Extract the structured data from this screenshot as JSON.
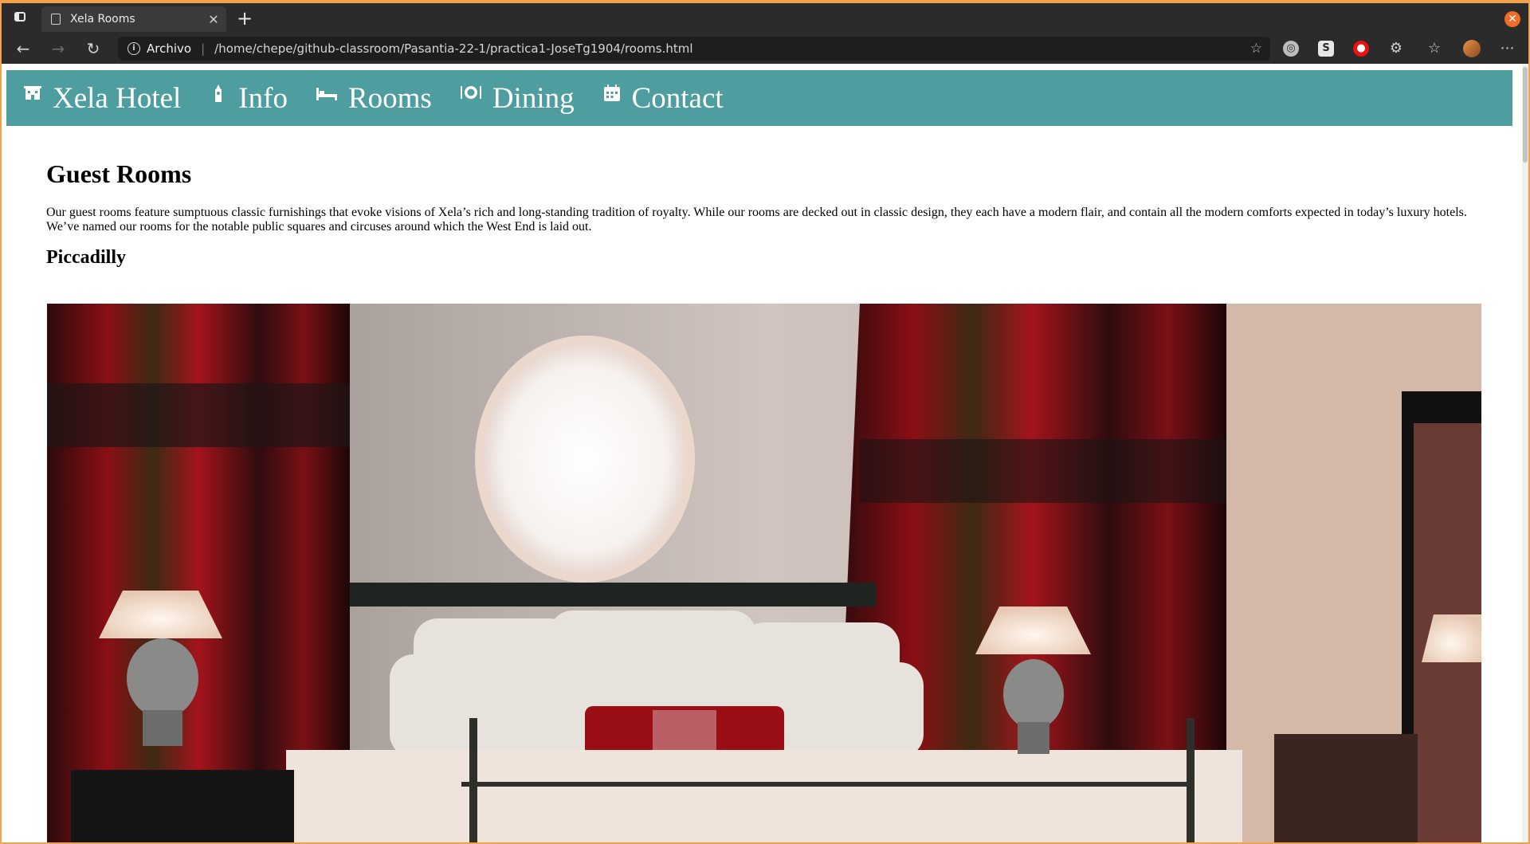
{
  "browser": {
    "tab_title": "Xela Rooms",
    "url_scheme_label": "Archivo",
    "url": "/home/chepe/github-classroom/Pasantia-22-1/practica1-JoseTg1904/rooms.html"
  },
  "site": {
    "nav": [
      {
        "label": "Xela Hotel",
        "icon": "hotel-icon"
      },
      {
        "label": "Info",
        "icon": "landmark-icon"
      },
      {
        "label": "Rooms",
        "icon": "bed-icon"
      },
      {
        "label": "Dining",
        "icon": "dining-icon"
      },
      {
        "label": "Contact",
        "icon": "calendar-icon"
      }
    ],
    "accent_color": "#4e9ea0"
  },
  "page": {
    "title": "Guest Rooms",
    "intro": "Our guest rooms feature sumptuous classic furnishings that evoke visions of Xela’s rich and long-standing tradition of royalty. While our rooms are decked out in classic design, they each have a modern flair, and contain all the modern comforts expected in today’s luxury hotels. We’ve named our rooms for the notable public squares and circuses around which the West End is laid out.",
    "room_name": "Piccadilly"
  }
}
